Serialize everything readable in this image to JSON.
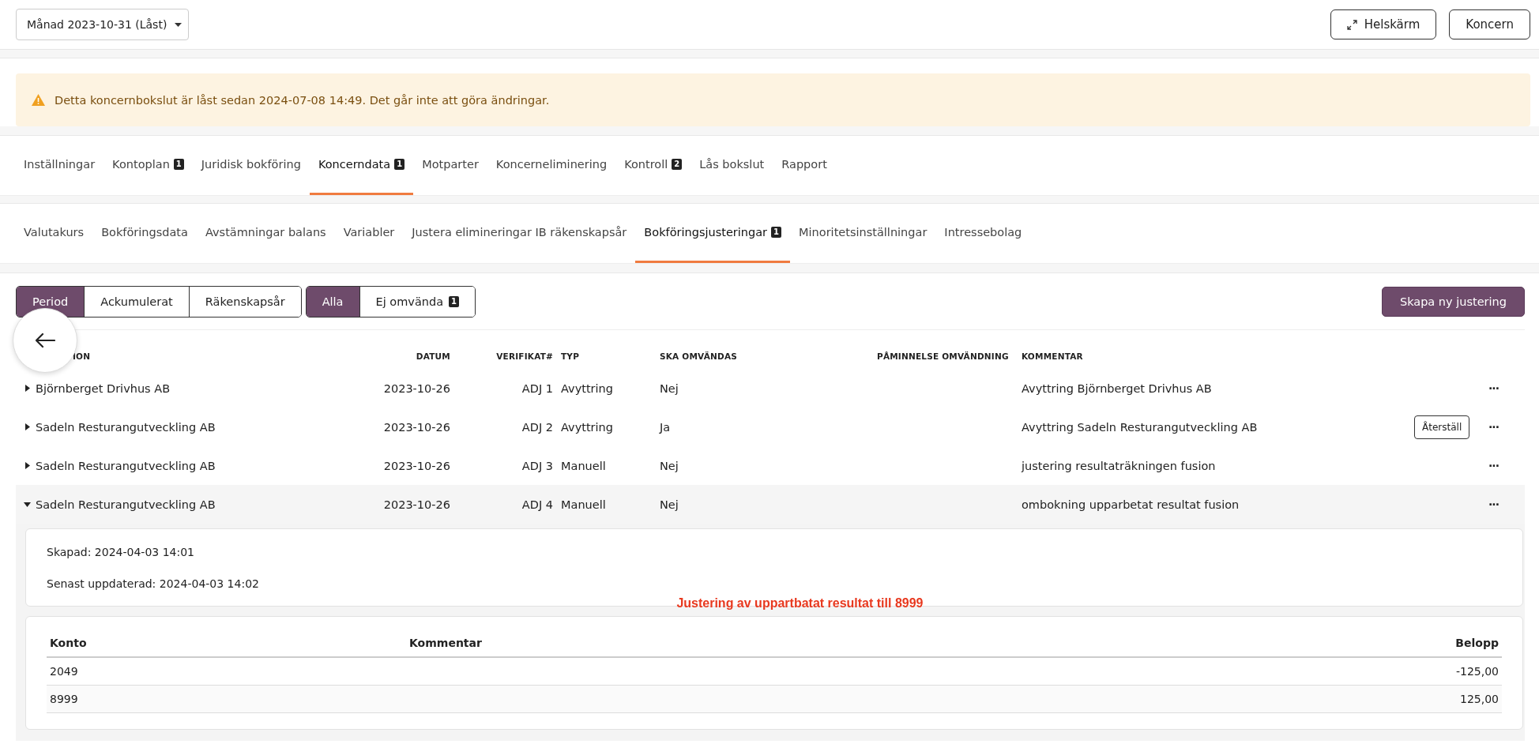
{
  "period_select": {
    "value": "Månad 2023-10-31 (Låst)"
  },
  "header_buttons": [
    {
      "label": "Helskärm",
      "kind": "fullscreen"
    },
    {
      "label": "Koncern",
      "kind": "plain"
    }
  ],
  "alert": {
    "kind": "warning",
    "text": "Detta koncernbokslut är låst sedan 2024-07-08 14:49. Det går inte att göra ändringar."
  },
  "tabs": [
    {
      "label": "Inställningar",
      "selected": false
    },
    {
      "label": "Kontoplan",
      "badge": "1",
      "selected": false
    },
    {
      "label": "Juridisk bokföring",
      "selected": false
    },
    {
      "label": "Koncerndata",
      "badge": "1",
      "selected": true
    },
    {
      "label": "Motparter",
      "selected": false
    },
    {
      "label": "Koncerneliminering",
      "selected": false
    },
    {
      "label": "Kontroll",
      "badge": "2",
      "selected": false
    },
    {
      "label": "Lås bokslut",
      "selected": false
    },
    {
      "label": "Rapport",
      "selected": false
    }
  ],
  "sub_tabs": [
    {
      "label": "Valutakurs",
      "selected": false
    },
    {
      "label": "Bokföringsdata",
      "selected": false
    },
    {
      "label": "Avstämningar balans",
      "selected": false
    },
    {
      "label": "Variabler",
      "selected": false
    },
    {
      "label": "Justera elimineringar IB räkenskapsår",
      "selected": false
    },
    {
      "label": "Bokföringsjusteringar",
      "badge": "1",
      "selected": true
    },
    {
      "label": "Minoritetsinställningar",
      "selected": false
    },
    {
      "label": "Intressebolag",
      "selected": false
    }
  ],
  "period_toggle": [
    {
      "label": "Period",
      "selected": true
    },
    {
      "label": "Ackumulerat",
      "selected": false
    },
    {
      "label": "Räkenskapsår",
      "selected": false
    }
  ],
  "filter_toggle": [
    {
      "label": "Alla",
      "selected": true
    },
    {
      "label": "Ej omvända",
      "badge": "1",
      "selected": false
    }
  ],
  "create_button": "Skapa ny justering",
  "table": {
    "columns": [
      "ION",
      "DATUM",
      "VERIFIKAT#",
      "TYP",
      "SKA OMVÄNDAS",
      "PÅMINNELSE OMVÄNDNING",
      "KOMMENTAR"
    ],
    "rows": [
      {
        "company": "Björnberget Drivhus AB",
        "date": "2023-10-26",
        "voucher": "ADJ 1",
        "type": "Avyttring",
        "reverse": "Nej",
        "comment": "Avyttring Björnberget Drivhus AB",
        "more": "···",
        "expanded": false
      },
      {
        "company": "Sadeln Resturangutveckling AB",
        "date": "2023-10-26",
        "voucher": "ADJ 2",
        "type": "Avyttring",
        "reverse": "Ja",
        "comment": "Avyttring Sadeln Resturangutveckling AB",
        "action": "Återställ",
        "more": "···",
        "expanded": false
      },
      {
        "company": "Sadeln Resturangutveckling AB",
        "date": "2023-10-26",
        "voucher": "ADJ 3",
        "type": "Manuell",
        "reverse": "Nej",
        "comment": "justering resultaträkningen fusion",
        "more": "···",
        "expanded": false
      },
      {
        "company": "Sadeln Resturangutveckling AB",
        "date": "2023-10-26",
        "voucher": "ADJ 4",
        "type": "Manuell",
        "reverse": "Nej",
        "comment": "ombokning upparbetat resultat fusion",
        "more": "···",
        "expanded": true,
        "details": {
          "created": "Skapad: 2024-04-03 14:01",
          "updated": "Senast uppdaterad: 2024-04-03 14:02",
          "lines": {
            "columns": [
              "Konto",
              "Kommentar",
              "Belopp"
            ],
            "rows": [
              {
                "account": "2049",
                "comment": "",
                "amount": "-125,00"
              },
              {
                "account": "8999",
                "comment": "",
                "amount": "125,00"
              }
            ]
          }
        }
      }
    ]
  },
  "annotation": "Justering av uppartbatat resultat till 8999"
}
